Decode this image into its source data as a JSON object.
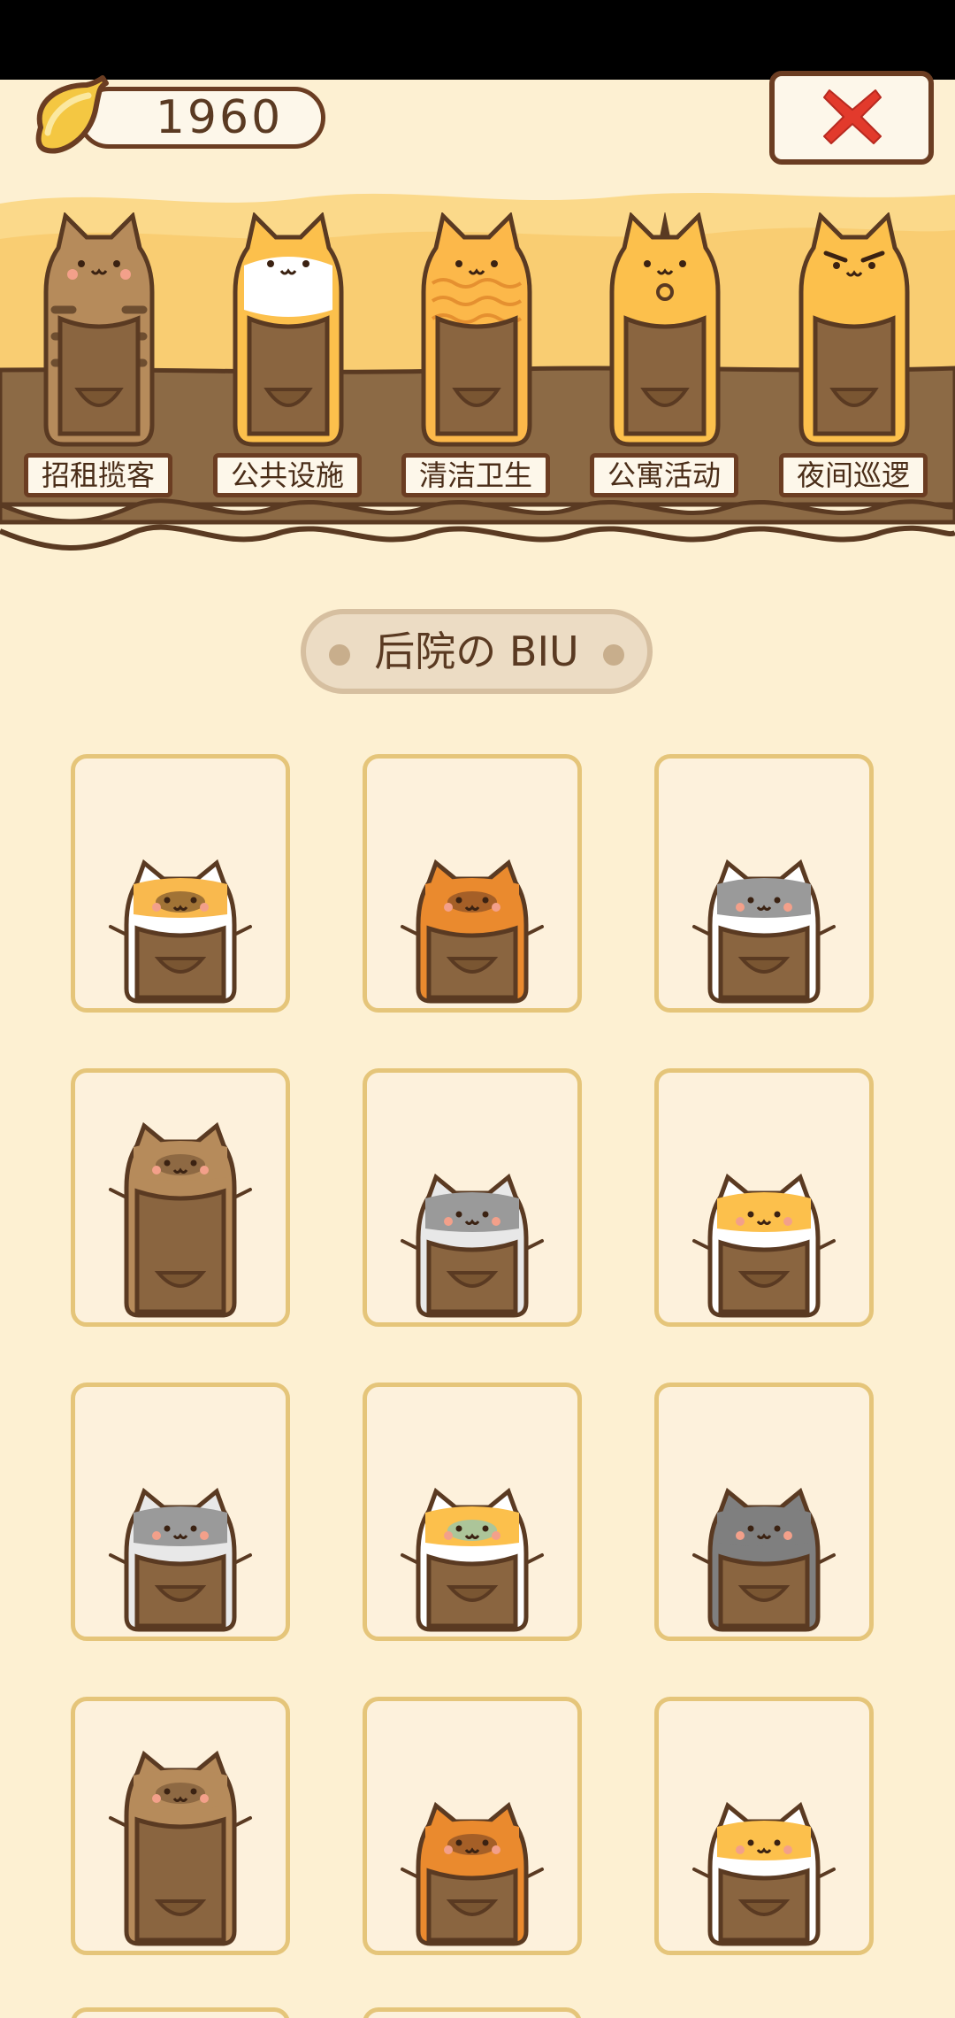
{
  "banana": {
    "count": "1960",
    "icon": "banana-icon"
  },
  "close_icon": "close-x-icon",
  "departments": [
    {
      "label": "招租揽客",
      "fur": "#b68b5b",
      "stripe": "#6e4e30",
      "belly": "#b68b5b"
    },
    {
      "label": "公共设施",
      "fur": "#fcc04c",
      "stripe": "#fcc04c",
      "belly": "#ffffff"
    },
    {
      "label": "清洁卫生",
      "fur": "#fcb84a",
      "stripe": "#e59030",
      "belly": "#fcb84a"
    },
    {
      "label": "公寓活动",
      "fur": "#fcc04c",
      "stripe": "#fcc04c",
      "belly": "#fcc04c"
    },
    {
      "label": "夜间巡逻",
      "fur": "#fcc04c",
      "stripe": "#fcc04c",
      "belly": "#fcc04c"
    }
  ],
  "section": {
    "title": "后院の BIU"
  },
  "cards": [
    {
      "name": "calico-cat",
      "fur": "#ffffff",
      "head": "#f9b94e",
      "patch": "#5a3a22"
    },
    {
      "name": "orange-tabby-cat",
      "fur": "#ea8a2e",
      "head": "#ea8a2e",
      "patch": "#6b3d22"
    },
    {
      "name": "grey-masked-cat",
      "fur": "#ffffff",
      "head": "#9a9a9a",
      "patch": "#9a9a9a"
    },
    {
      "name": "brown-tabby-tall-cat",
      "fur": "#b68b5b",
      "head": "#b68b5b",
      "patch": "#6e4e30"
    },
    {
      "name": "grey-white-cat",
      "fur": "#e8e8e8",
      "head": "#9a9a9a",
      "patch": "#9a9a9a"
    },
    {
      "name": "hat-cat",
      "fur": "#ffffff",
      "head": "#fcc04c",
      "patch": "#fcc04c"
    },
    {
      "name": "grey-masked-cat-2",
      "fur": "#e8e8e8",
      "head": "#9a9a9a",
      "patch": "#9a9a9a"
    },
    {
      "name": "bow-cat",
      "fur": "#ffffff",
      "head": "#fcc04c",
      "patch": "#6ac9d8"
    },
    {
      "name": "dark-grey-cat",
      "fur": "#7f7f7f",
      "head": "#7f7f7f",
      "patch": "#7f7f7f"
    },
    {
      "name": "brown-tabby-tall-cat-2",
      "fur": "#b68b5b",
      "head": "#b68b5b",
      "patch": "#6e4e30"
    },
    {
      "name": "orange-tabby-cat-2",
      "fur": "#ea8a2e",
      "head": "#ea8a2e",
      "patch": "#6b3d22"
    },
    {
      "name": "yellow-white-cat",
      "fur": "#ffffff",
      "head": "#fcc04c",
      "patch": "#fcc04c"
    }
  ]
}
